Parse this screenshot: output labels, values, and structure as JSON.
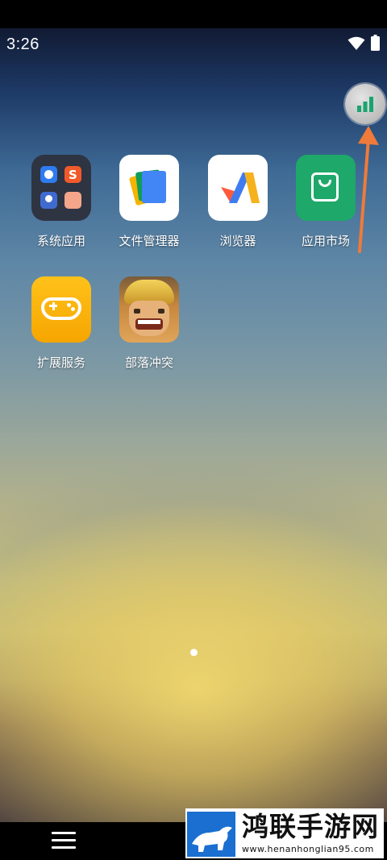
{
  "status_bar": {
    "time": "3:26",
    "icons": [
      "wifi-icon",
      "battery-icon"
    ]
  },
  "floating_ball": {
    "icon": "signal-bars-icon",
    "color": "#19a974"
  },
  "annotation": {
    "icon": "arrow-up-icon",
    "color": "#f07a3a"
  },
  "apps": [
    {
      "label": "系统应用",
      "icon": "folder-icon"
    },
    {
      "label": "文件管理器",
      "icon": "files-icon"
    },
    {
      "label": "浏览器",
      "icon": "browser-icon"
    },
    {
      "label": "应用市场",
      "icon": "app-store-icon"
    },
    {
      "label": "扩展服务",
      "icon": "gamepad-icon"
    },
    {
      "label": "部落冲突",
      "icon": "clash-of-clans-icon"
    }
  ],
  "page_indicator": {
    "current": 1,
    "total": 1
  },
  "nav_bar": {
    "menu_icon": "menu-icon"
  },
  "watermark": {
    "title": "鸿联手游网",
    "url": "www.henanhonglian95.com"
  }
}
